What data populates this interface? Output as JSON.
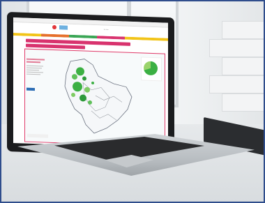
{
  "scene": {
    "description_tags": [
      "laptop-on-desk"
    ],
    "screen": {
      "page_title_small": "",
      "panel_text_lines": [
        "",
        "",
        ""
      ],
      "legend_labels": []
    }
  },
  "colors": {
    "accent_pink": "#d8336e",
    "map_green": "#3cb043",
    "frame_blue": "#2f4d8c"
  }
}
